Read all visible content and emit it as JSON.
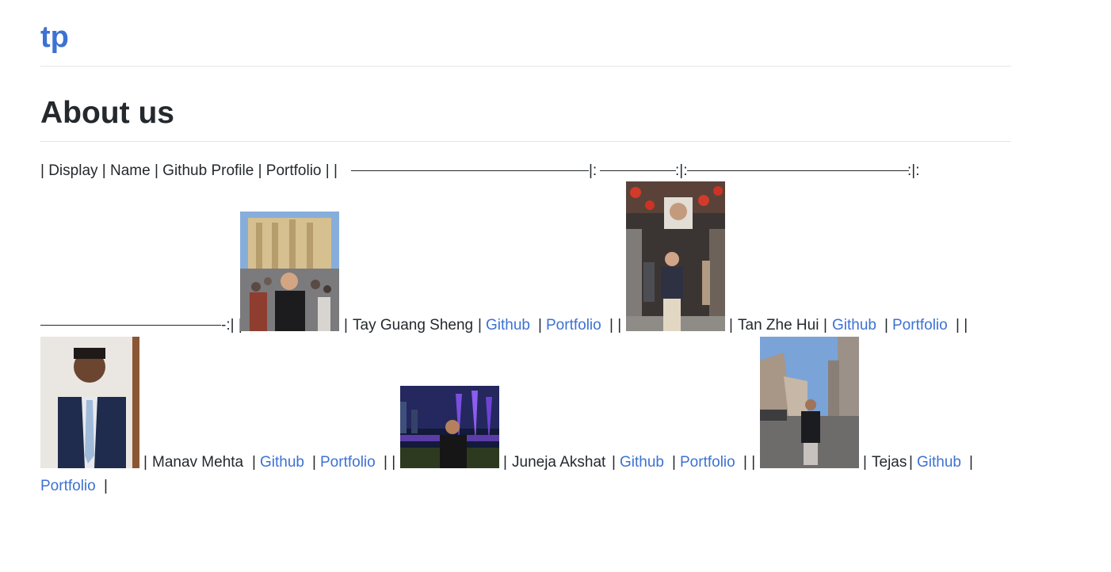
{
  "site": {
    "title": "tp"
  },
  "page": {
    "heading": "About us"
  },
  "table_text": {
    "header": "| Display | Name | Github Profile | Portfolio | |",
    "sep_mid1": "|:",
    "sep_mid2": ":|:",
    "sep_end": ":|:",
    "sep_tail": "-:| |",
    "pipe": "|",
    "pipe_pair": "| |"
  },
  "members": [
    {
      "name": "Tay Guang Sheng",
      "github_label": "Github",
      "portfolio_label": "Portfolio",
      "photo": "tay-guang-sheng-photo"
    },
    {
      "name": "Tan Zhe Hui",
      "github_label": "Github",
      "portfolio_label": "Portfolio",
      "photo": "tan-zhe-hui-photo"
    },
    {
      "name": "Manav Mehta",
      "github_label": "Github",
      "portfolio_label": "Portfolio",
      "photo": "manav-mehta-photo"
    },
    {
      "name": "Juneja Akshat",
      "github_label": "Github",
      "portfolio_label": "Portfolio",
      "photo": "juneja-akshat-photo"
    },
    {
      "name": "Tejas",
      "github_label": "Github",
      "portfolio_label": "Portfolio",
      "photo": "tejas-photo"
    }
  ],
  "colors": {
    "link": "#3d72d1",
    "text": "#24292e",
    "divider": "#e4e6e8"
  }
}
